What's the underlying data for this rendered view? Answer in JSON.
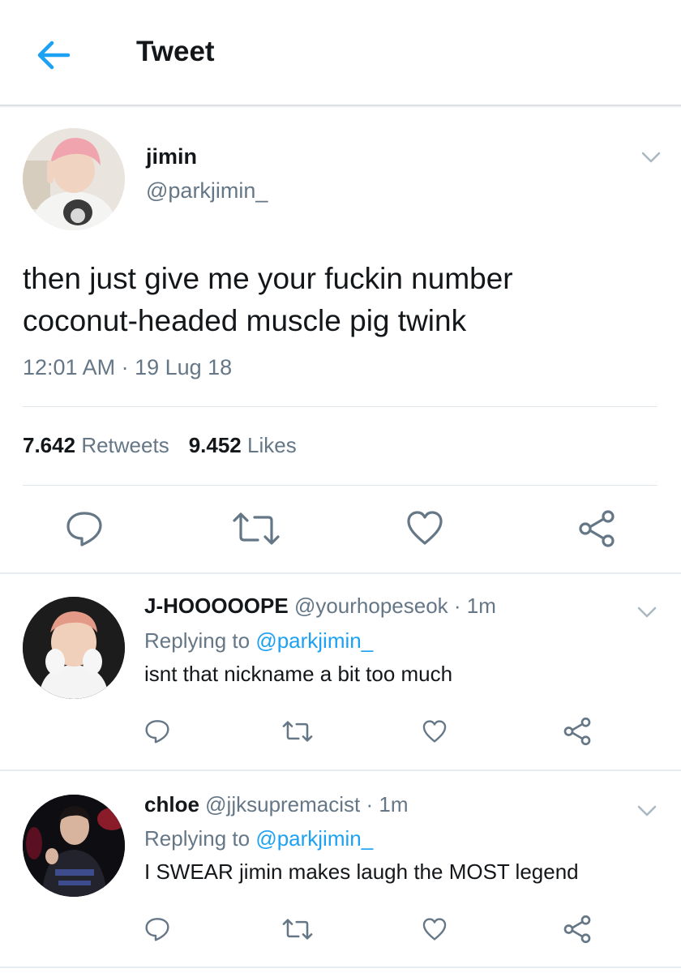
{
  "header": {
    "title": "Tweet"
  },
  "tweet": {
    "name": "jimin",
    "handle": "@parkjimin_",
    "text_line1": "then just give me your fuckin number",
    "text_line2": "coconut-headed muscle pig twink",
    "timestamp": "12:01 AM · 19 Lug 18",
    "retweets_count": "7.642",
    "retweets_label": "Retweets",
    "likes_count": "9.452",
    "likes_label": "Likes"
  },
  "replies": [
    {
      "name": "J-HOOOOOPE",
      "handle": "@yourhopeseok",
      "separator": " · ",
      "time": "1m",
      "replying_prefix": "Replying to ",
      "replying_to": "@parkjimin_",
      "text": "isnt that nickname a bit too much"
    },
    {
      "name": "chloe",
      "handle": "@jjksupremacist",
      "separator": " · ",
      "time": "1m",
      "replying_prefix": "Replying to ",
      "replying_to": "@parkjimin_",
      "text": "I SWEAR jimin makes laugh the MOST legend"
    }
  ],
  "icons": {
    "back": "arrow-left-icon",
    "caret": "chevron-down-icon",
    "reply": "speech-bubble-icon",
    "retweet": "retweet-icon",
    "like": "heart-icon",
    "share": "share-icon"
  },
  "colors": {
    "accent": "#1da1f2",
    "text": "#14171a",
    "secondary": "#657786",
    "divider": "#e1e8ed"
  }
}
